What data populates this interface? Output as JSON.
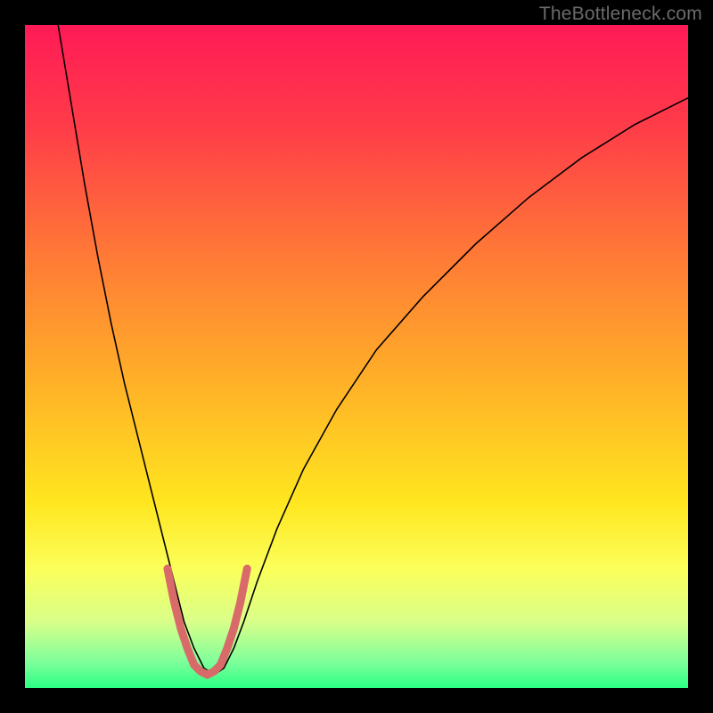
{
  "watermark": "TheBottleneck.com",
  "chart_data": {
    "type": "line",
    "title": "",
    "xlabel": "",
    "ylabel": "",
    "xlim": [
      0,
      100
    ],
    "ylim": [
      0,
      100
    ],
    "grid": false,
    "legend": false,
    "background_gradient": {
      "stops": [
        {
          "offset": 0.0,
          "color": "#ff1a57"
        },
        {
          "offset": 0.15,
          "color": "#ff3b49"
        },
        {
          "offset": 0.35,
          "color": "#ff7a36"
        },
        {
          "offset": 0.55,
          "color": "#ffb427"
        },
        {
          "offset": 0.72,
          "color": "#ffe61f"
        },
        {
          "offset": 0.82,
          "color": "#fbff5a"
        },
        {
          "offset": 0.9,
          "color": "#d9ff8a"
        },
        {
          "offset": 0.96,
          "color": "#7fff9a"
        },
        {
          "offset": 1.0,
          "color": "#2bff84"
        }
      ]
    },
    "series": [
      {
        "name": "bottleneck-curve",
        "color": "#000000",
        "width": 1.6,
        "x": [
          5,
          7,
          9,
          11,
          13,
          15,
          17,
          19,
          21,
          22.5,
          24,
          25.5,
          27,
          28.5,
          30,
          31.5,
          33,
          35,
          38,
          42,
          47,
          53,
          60,
          68,
          76,
          84,
          92,
          100
        ],
        "y": [
          100,
          88,
          76,
          65,
          55,
          46,
          38,
          30,
          22,
          16,
          10,
          6,
          3,
          2,
          3,
          6,
          10,
          16,
          24,
          33,
          42,
          51,
          59,
          67,
          74,
          80,
          85,
          89
        ]
      }
    ],
    "highlight": {
      "name": "valley-highlight",
      "color": "#d96a6a",
      "width": 9,
      "x": [
        21.5,
        22.5,
        23.5,
        24.5,
        25.5,
        26.5,
        27.5,
        28.5,
        29.5,
        30.5,
        31.5,
        32.5,
        33.5
      ],
      "y": [
        18,
        13,
        9,
        6,
        3.5,
        2.5,
        2,
        2.5,
        3.5,
        6,
        9,
        13,
        18
      ]
    }
  }
}
